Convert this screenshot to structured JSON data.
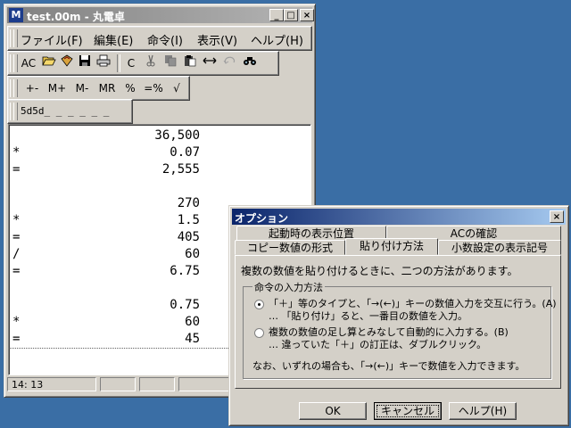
{
  "main_window": {
    "title": "test.00m - 丸電卓",
    "app_icon": "M",
    "controls": {
      "minimize": "_",
      "maximize": "□",
      "close": "×"
    }
  },
  "menu": [
    "ファイル(F)",
    "編集(E)",
    "命令(I)",
    "表示(V)",
    "ヘルプ(H)"
  ],
  "toolbar1": {
    "ac": "AC",
    "icons": [
      "open-folder-icon",
      "new-file-icon",
      "save-icon",
      "print-icon",
      "clear-icon",
      "cut-icon",
      "copy-icon",
      "paste-icon",
      "swap-icon",
      "undo-icon",
      "find-icon"
    ],
    "c": "C"
  },
  "toolbar2": {
    "buttons": [
      "+-",
      "M+",
      "M-",
      "MR",
      "%",
      "=%",
      "√"
    ]
  },
  "format_bar": {
    "value": "5d5d_ _ _ _ _ _"
  },
  "tape": [
    {
      "op": "",
      "value": "36,500"
    },
    {
      "op": "*",
      "value": "0.07"
    },
    {
      "op": "=",
      "value": "2,555"
    },
    {
      "op": "",
      "value": ""
    },
    {
      "op": "",
      "value": "270"
    },
    {
      "op": "*",
      "value": "1.5"
    },
    {
      "op": "=",
      "value": "405"
    },
    {
      "op": "/",
      "value": "60"
    },
    {
      "op": "=",
      "value": "6.75"
    },
    {
      "op": "",
      "value": ""
    },
    {
      "op": "",
      "value": "0.75"
    },
    {
      "op": "*",
      "value": "60"
    },
    {
      "op": "=",
      "value": "45"
    }
  ],
  "status": {
    "position": "14: 13"
  },
  "dialog": {
    "title": "オプション",
    "close": "×",
    "tabs_back": [
      "起動時の表示位置",
      "ACの確認"
    ],
    "tabs_front": [
      "コピー数値の形式",
      "貼り付け方法",
      "小数設定の表示記号"
    ],
    "description": "複数の数値を貼り付けるときに、二つの方法があります。",
    "group_label": "命令の入力方法",
    "option_a_line1": "「＋」等のタイプと、「→(←)」キーの数値入力を交互に行う。(A)",
    "option_a_line2": "… 「貼り付け」ると、一番目の数値を入力。",
    "option_b_line1": "複数の数値の足し算とみなして自動的に入力する。(B)",
    "option_b_line2": "… 違っていた「＋」の訂正は、ダブルクリック。",
    "note": "なお、いずれの場合も、「→(←)」キーで数値を入力できます。",
    "buttons": {
      "ok": "OK",
      "cancel": "キャンセル",
      "help": "ヘルプ(H)"
    }
  }
}
